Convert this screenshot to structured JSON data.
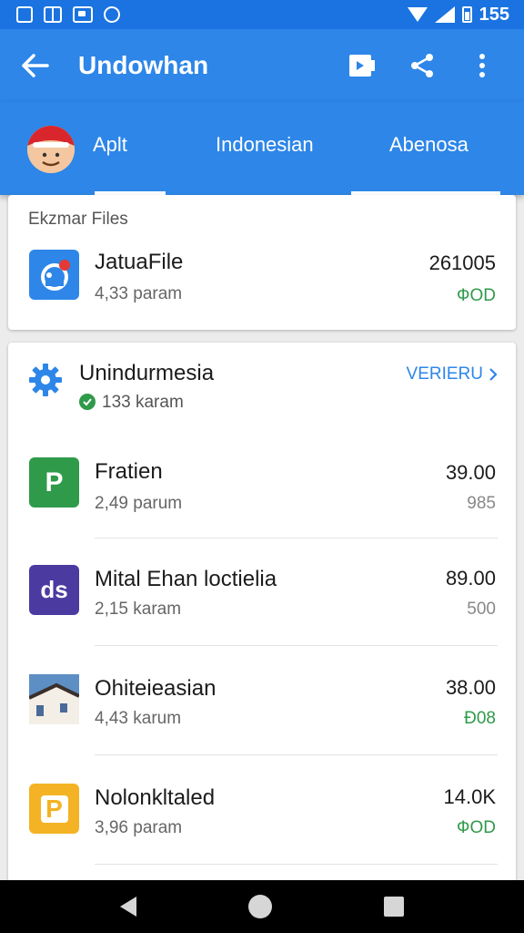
{
  "status_bar": {
    "time": "155",
    "icons": [
      "notification-icon",
      "grid-icon",
      "photo-icon",
      "chat-icon",
      "wifi-icon",
      "signal-icon",
      "battery-icon"
    ]
  },
  "app_bar": {
    "title": "Undowhan",
    "icons": [
      "back-arrow-icon",
      "video-icon",
      "share-icon",
      "more-vert-icon"
    ]
  },
  "tabs": [
    {
      "label": "Aplt",
      "selected": true
    },
    {
      "label": "Indonesian",
      "selected": false
    },
    {
      "label": "Abenosa",
      "selected": false
    }
  ],
  "files_section": {
    "label": "Ekzmar Files",
    "item": {
      "title": "JatuaFile",
      "subtitle": "4,33 param",
      "value": "261005",
      "tag": "ФOD"
    }
  },
  "main_section": {
    "title": "Unindurmesia",
    "subtitle": "133 karam",
    "view_all": "VERIERU",
    "items": [
      {
        "title": "Fratien",
        "subtitle": "2,49 parum",
        "value": "39.00",
        "tag": "985",
        "tag_color": "gray",
        "icon_text": "P",
        "icon_color": "#2f9a4a"
      },
      {
        "title": "Mital Ehan loctielia",
        "subtitle": "2,15 karam",
        "value": "89.00",
        "tag": "500",
        "tag_color": "gray",
        "icon_text": "ds",
        "icon_color": "#4b3aa0"
      },
      {
        "title": "Ohiteieasian",
        "subtitle": "4,43 karum",
        "value": "38.00",
        "tag": "Ð08",
        "tag_color": "green",
        "icon_text": "",
        "icon_color": "#7aa0c6"
      },
      {
        "title": "Nolonkltaled",
        "subtitle": "3,96 param",
        "value": "14.0K",
        "tag": "ФOD",
        "tag_color": "green",
        "icon_text": "P",
        "icon_color": "#f4b324"
      }
    ]
  },
  "colors": {
    "primary": "#2d86e8",
    "status_bar": "#1a73e0",
    "green": "#2f9a4a",
    "link": "#2d86e8"
  }
}
